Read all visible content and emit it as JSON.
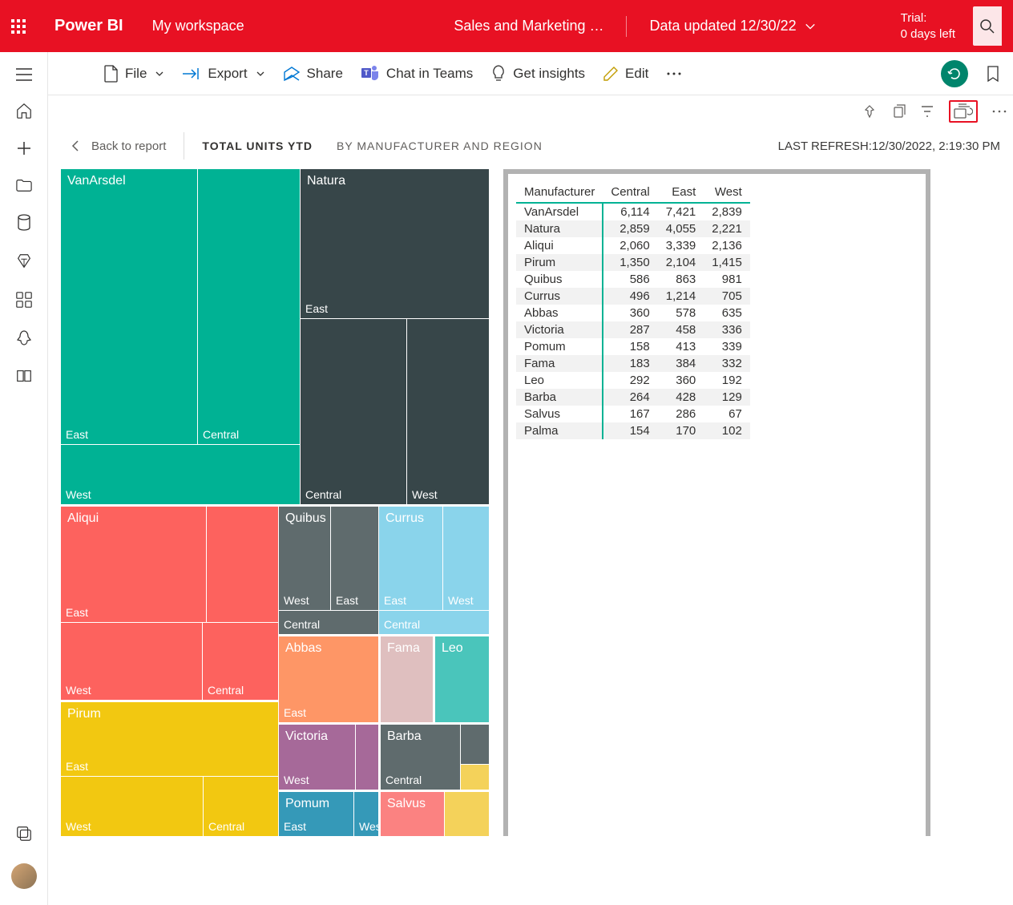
{
  "header": {
    "brand": "Power BI",
    "workspace": "My workspace",
    "report_title": "Sales and Marketing …",
    "data_updated": "Data updated 12/30/22",
    "trial_line1": "Trial:",
    "trial_line2": "0 days left"
  },
  "cmdbar": {
    "file": "File",
    "export": "Export",
    "share": "Share",
    "chat": "Chat in Teams",
    "insights": "Get insights",
    "edit": "Edit"
  },
  "page": {
    "back": "Back to report",
    "title": "TOTAL UNITS YTD",
    "subtitle": "BY MANUFACTURER AND REGION",
    "refresh_label": "LAST REFRESH:",
    "refresh_ts": "12/30/2022, 2:19:30 PM"
  },
  "table": {
    "headers": [
      "Manufacturer",
      "Central",
      "East",
      "West"
    ],
    "rows": [
      {
        "m": "VanArsdel",
        "c": "6,114",
        "e": "7,421",
        "w": "2,839"
      },
      {
        "m": "Natura",
        "c": "2,859",
        "e": "4,055",
        "w": "2,221"
      },
      {
        "m": "Aliqui",
        "c": "2,060",
        "e": "3,339",
        "w": "2,136"
      },
      {
        "m": "Pirum",
        "c": "1,350",
        "e": "2,104",
        "w": "1,415"
      },
      {
        "m": "Quibus",
        "c": "586",
        "e": "863",
        "w": "981"
      },
      {
        "m": "Currus",
        "c": "496",
        "e": "1,214",
        "w": "705"
      },
      {
        "m": "Abbas",
        "c": "360",
        "e": "578",
        "w": "635"
      },
      {
        "m": "Victoria",
        "c": "287",
        "e": "458",
        "w": "336"
      },
      {
        "m": "Pomum",
        "c": "158",
        "e": "413",
        "w": "339"
      },
      {
        "m": "Fama",
        "c": "183",
        "e": "384",
        "w": "332"
      },
      {
        "m": "Leo",
        "c": "292",
        "e": "360",
        "w": "192"
      },
      {
        "m": "Barba",
        "c": "264",
        "e": "428",
        "w": "129"
      },
      {
        "m": "Salvus",
        "c": "167",
        "e": "286",
        "w": "67"
      },
      {
        "m": "Palma",
        "c": "154",
        "e": "170",
        "w": "102"
      }
    ]
  },
  "chart_data": {
    "type": "treemap",
    "title": "Total Units YTD by Manufacturer and Region",
    "group_field": "Manufacturer",
    "detail_field": "Region",
    "value_field": "Total Units YTD",
    "data": [
      {
        "manufacturer": "VanArsdel",
        "region": "Central",
        "value": 6114
      },
      {
        "manufacturer": "VanArsdel",
        "region": "East",
        "value": 7421
      },
      {
        "manufacturer": "VanArsdel",
        "region": "West",
        "value": 2839
      },
      {
        "manufacturer": "Natura",
        "region": "Central",
        "value": 2859
      },
      {
        "manufacturer": "Natura",
        "region": "East",
        "value": 4055
      },
      {
        "manufacturer": "Natura",
        "region": "West",
        "value": 2221
      },
      {
        "manufacturer": "Aliqui",
        "region": "Central",
        "value": 2060
      },
      {
        "manufacturer": "Aliqui",
        "region": "East",
        "value": 3339
      },
      {
        "manufacturer": "Aliqui",
        "region": "West",
        "value": 2136
      },
      {
        "manufacturer": "Pirum",
        "region": "Central",
        "value": 1350
      },
      {
        "manufacturer": "Pirum",
        "region": "East",
        "value": 2104
      },
      {
        "manufacturer": "Pirum",
        "region": "West",
        "value": 1415
      },
      {
        "manufacturer": "Quibus",
        "region": "Central",
        "value": 586
      },
      {
        "manufacturer": "Quibus",
        "region": "East",
        "value": 863
      },
      {
        "manufacturer": "Quibus",
        "region": "West",
        "value": 981
      },
      {
        "manufacturer": "Currus",
        "region": "Central",
        "value": 496
      },
      {
        "manufacturer": "Currus",
        "region": "East",
        "value": 1214
      },
      {
        "manufacturer": "Currus",
        "region": "West",
        "value": 705
      },
      {
        "manufacturer": "Abbas",
        "region": "Central",
        "value": 360
      },
      {
        "manufacturer": "Abbas",
        "region": "East",
        "value": 578
      },
      {
        "manufacturer": "Abbas",
        "region": "West",
        "value": 635
      },
      {
        "manufacturer": "Victoria",
        "region": "Central",
        "value": 287
      },
      {
        "manufacturer": "Victoria",
        "region": "East",
        "value": 458
      },
      {
        "manufacturer": "Victoria",
        "region": "West",
        "value": 336
      },
      {
        "manufacturer": "Pomum",
        "region": "Central",
        "value": 158
      },
      {
        "manufacturer": "Pomum",
        "region": "East",
        "value": 413
      },
      {
        "manufacturer": "Pomum",
        "region": "West",
        "value": 339
      },
      {
        "manufacturer": "Fama",
        "region": "Central",
        "value": 183
      },
      {
        "manufacturer": "Fama",
        "region": "East",
        "value": 384
      },
      {
        "manufacturer": "Fama",
        "region": "West",
        "value": 332
      },
      {
        "manufacturer": "Leo",
        "region": "Central",
        "value": 292
      },
      {
        "manufacturer": "Leo",
        "region": "East",
        "value": 360
      },
      {
        "manufacturer": "Leo",
        "region": "West",
        "value": 192
      },
      {
        "manufacturer": "Barba",
        "region": "Central",
        "value": 264
      },
      {
        "manufacturer": "Barba",
        "region": "East",
        "value": 428
      },
      {
        "manufacturer": "Barba",
        "region": "West",
        "value": 129
      },
      {
        "manufacturer": "Salvus",
        "region": "Central",
        "value": 167
      },
      {
        "manufacturer": "Salvus",
        "region": "East",
        "value": 286
      },
      {
        "manufacturer": "Salvus",
        "region": "West",
        "value": 67
      },
      {
        "manufacturer": "Palma",
        "region": "Central",
        "value": 154
      },
      {
        "manufacturer": "Palma",
        "region": "East",
        "value": 170
      },
      {
        "manufacturer": "Palma",
        "region": "West",
        "value": 102
      }
    ],
    "colors": {
      "VanArsdel": "#00b294",
      "Natura": "#374649",
      "Aliqui": "#fd625e",
      "Pirum": "#f2c811",
      "Quibus": "#5f6b6d",
      "Currus": "#8ad4eb",
      "Abbas": "#fe9666",
      "Victoria": "#a66999",
      "Pomum": "#3599b8",
      "Fama": "#dfbfbf",
      "Leo": "#4ac5bb",
      "Barba": "#5f6b6d",
      "Salvus": "#fb8281",
      "Palma": "#f4d25a"
    }
  },
  "treemap_labels": {
    "VanArsdel": "VanArsdel",
    "Natura": "Natura",
    "Aliqui": "Aliqui",
    "Pirum": "Pirum",
    "Quibus": "Quibus",
    "Currus": "Currus",
    "Abbas": "Abbas",
    "Victoria": "Victoria",
    "Pomum": "Pomum",
    "Fama": "Fama",
    "Leo": "Leo",
    "Barba": "Barba",
    "Salvus": "Salvus",
    "East": "East",
    "West": "West",
    "Central": "Central"
  }
}
